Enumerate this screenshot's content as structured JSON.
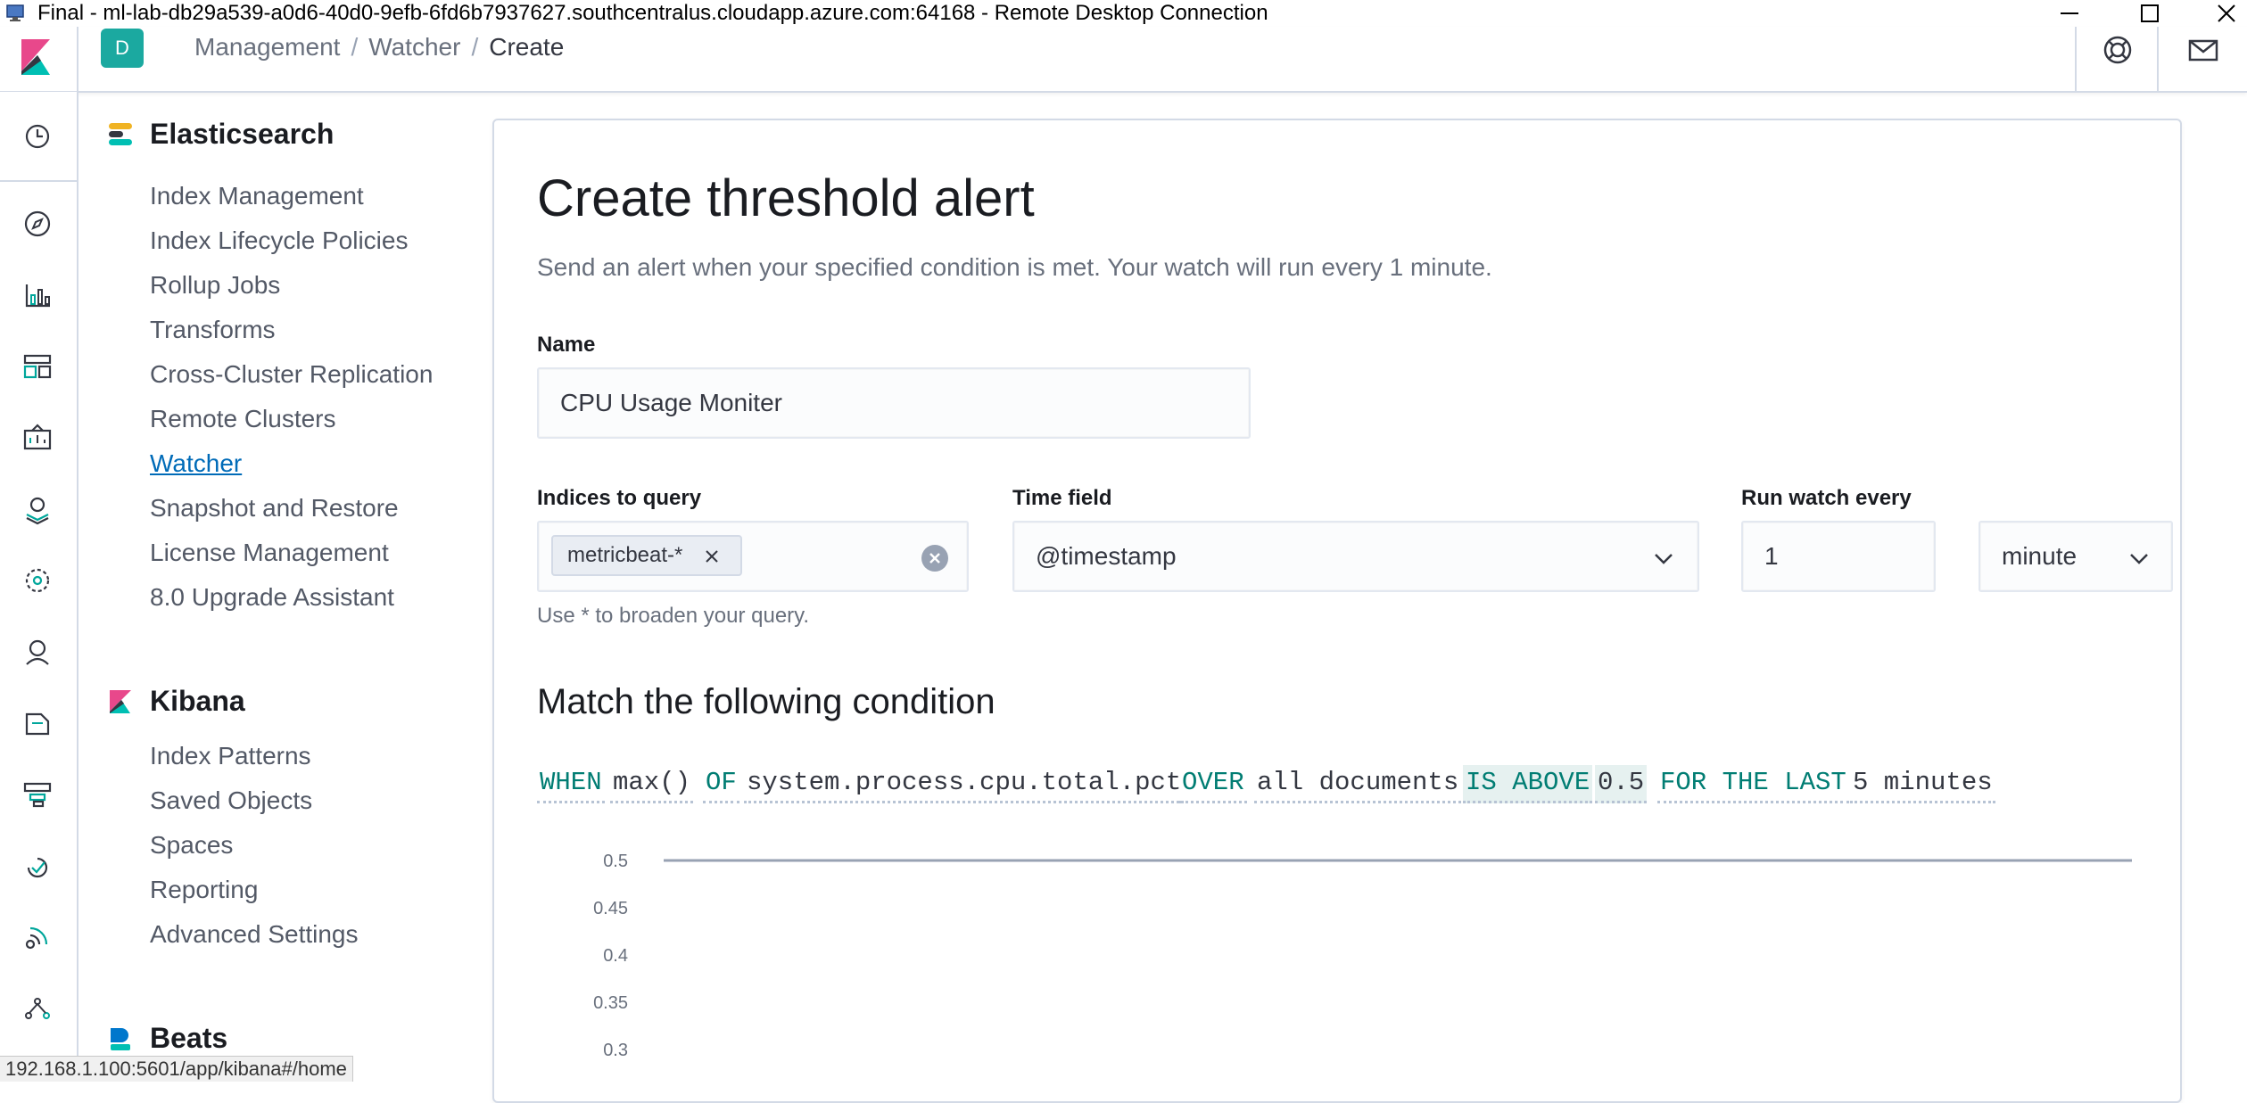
{
  "window": {
    "title": "Final - ml-lab-db29a539-a0d6-40d0-9efb-6fd6b7937627.southcentralus.cloudapp.azure.com:64168 - Remote Desktop Connection"
  },
  "header": {
    "space_initial": "D",
    "breadcrumbs": [
      "Management",
      "Watcher",
      "Create"
    ]
  },
  "sidenav": {
    "sections": [
      {
        "title": "Elasticsearch",
        "items": [
          "Index Management",
          "Index Lifecycle Policies",
          "Rollup Jobs",
          "Transforms",
          "Cross-Cluster Replication",
          "Remote Clusters",
          "Watcher",
          "Snapshot and Restore",
          "License Management",
          "8.0 Upgrade Assistant"
        ],
        "active_item": "Watcher"
      },
      {
        "title": "Kibana",
        "items": [
          "Index Patterns",
          "Saved Objects",
          "Spaces",
          "Reporting",
          "Advanced Settings"
        ]
      },
      {
        "title": "Beats",
        "items": []
      }
    ]
  },
  "form": {
    "title": "Create threshold alert",
    "description": "Send an alert when your specified condition is met. Your watch will run every 1 minute.",
    "name_label": "Name",
    "name_value": "CPU Usage Moniter",
    "indices_label": "Indices to query",
    "indices_values": [
      "metricbeat-*"
    ],
    "indices_help": "Use * to broaden your query.",
    "time_field_label": "Time field",
    "time_field_value": "@timestamp",
    "run_every_label": "Run watch every",
    "run_every_value": "1",
    "run_every_unit": "minute",
    "condition_title": "Match the following condition",
    "condition": {
      "when": "WHEN",
      "agg": "max()",
      "of": "OF",
      "field": "system.process.cpu.total.pct",
      "over": "OVER",
      "group": "all documents",
      "comparator": "IS ABOVE",
      "threshold": "0.5",
      "for_the_last": "FOR THE LAST",
      "window": "5 minutes"
    }
  },
  "chart_data": {
    "type": "line",
    "y_ticks": [
      "0.5",
      "0.45",
      "0.4",
      "0.35",
      "0.3"
    ],
    "series": [
      {
        "values": [
          0.5,
          0.5
        ]
      }
    ],
    "ylim": [
      0.3,
      0.5
    ]
  },
  "status_url": "192.168.1.100:5601/app/kibana#/home"
}
